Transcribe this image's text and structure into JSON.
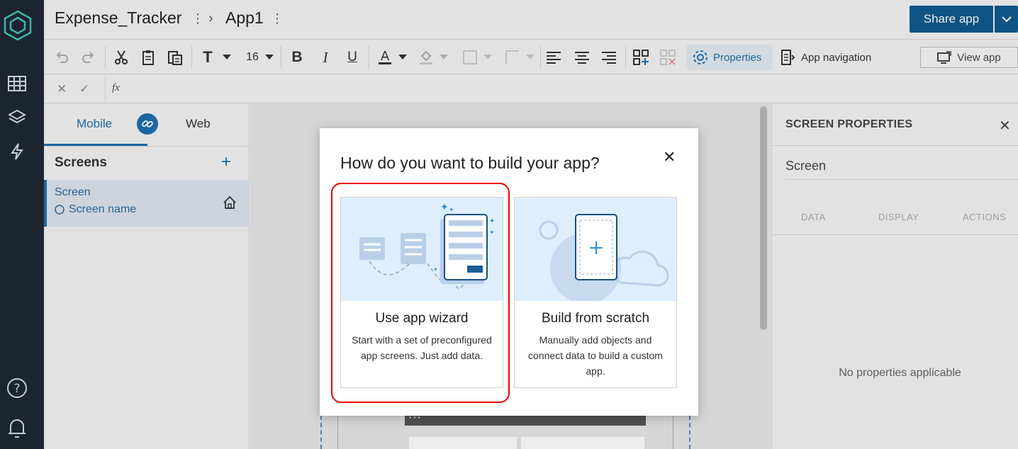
{
  "topbar": {
    "project_name": "Expense_Tracker",
    "app_name": "App1",
    "share_label": "Share app"
  },
  "toolbar": {
    "font_size": "16",
    "properties_label": "Properties",
    "app_navigation_label": "App navigation",
    "view_app_label": "View app"
  },
  "formula": {
    "fx": "fx"
  },
  "left_panel": {
    "tabs": [
      {
        "label": "Mobile",
        "active": true
      },
      {
        "label": "Web",
        "active": false
      }
    ],
    "screens_heading": "Screens",
    "add_symbol": "+",
    "screen_item": {
      "title": "Screen",
      "subtitle": "Screen name"
    }
  },
  "right_panel": {
    "title": "SCREEN PROPERTIES",
    "screen_label": "Screen",
    "tabs": [
      "DATA",
      "DISPLAY",
      "ACTIONS"
    ],
    "empty_message": "No properties applicable"
  },
  "modal": {
    "title": "How do you want to build your app?",
    "close_symbol": "✕",
    "options": [
      {
        "title": "Use app wizard",
        "description": "Start with a set of preconfigured app screens. Just add data.",
        "highlighted": true
      },
      {
        "title": "Build from scratch",
        "description": "Manually add objects and connect data to build a custom app.",
        "highlighted": false
      }
    ]
  },
  "colors": {
    "brand": "#0f5b8e",
    "accent": "#1f6fae",
    "rail_bg": "#1c2430",
    "highlight": "#e00000",
    "card_art_bg": "#deeefd"
  }
}
